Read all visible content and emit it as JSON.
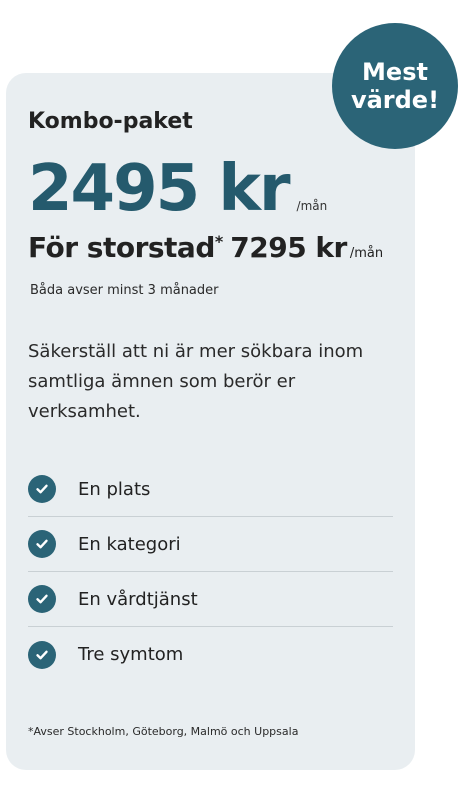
{
  "badge": {
    "label": "Mest värde!"
  },
  "plan": {
    "name": "Kombo-paket",
    "price": "2495 kr",
    "price_unit": "/mån",
    "city_label": "För storstad",
    "city_marker": "*",
    "city_price": "7295 kr",
    "city_unit": "/mån",
    "min_term_note": "Båda avser minst 3 månader",
    "description": "Säkerställ att ni är mer sökbara inom samtliga ämnen som berör er verksamhet."
  },
  "features": [
    {
      "icon": "check-circle-icon",
      "label": "En plats"
    },
    {
      "icon": "check-circle-icon",
      "label": "En kategori"
    },
    {
      "icon": "check-circle-icon",
      "label": "En vårdtjänst"
    },
    {
      "icon": "check-circle-icon",
      "label": "Tre symtom"
    }
  ],
  "footnote": "*Avser Stockholm, Göteborg, Malmö och Uppsala",
  "colors": {
    "accent": "#2b6477",
    "price": "#255a6d",
    "card_background": "#e9eef1",
    "divider": "#c9d0d4"
  }
}
